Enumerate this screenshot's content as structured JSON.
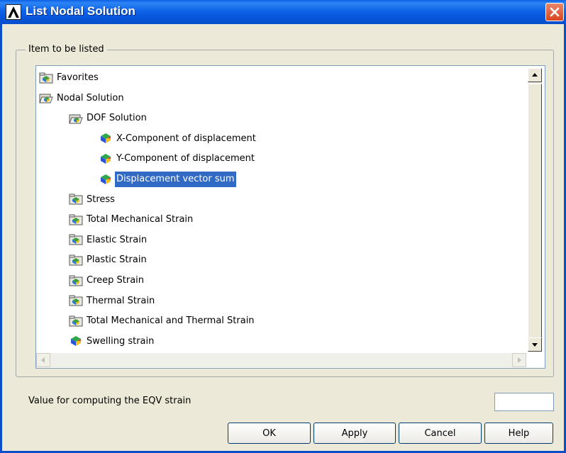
{
  "window": {
    "title": "List Nodal Solution",
    "close_icon": "close-icon"
  },
  "group": {
    "legend": "Item to be listed"
  },
  "tree": [
    {
      "label": "Favorites",
      "level": 0,
      "icon": "folder-icon",
      "selected": false
    },
    {
      "label": "Nodal Solution",
      "level": 0,
      "icon": "open-folder-icon",
      "selected": false
    },
    {
      "label": "DOF Solution",
      "level": 1,
      "icon": "open-folder-icon",
      "selected": false
    },
    {
      "label": "X-Component of displacement",
      "level": 2,
      "icon": "cube-icon",
      "selected": false
    },
    {
      "label": "Y-Component of displacement",
      "level": 2,
      "icon": "cube-icon",
      "selected": false
    },
    {
      "label": "Displacement vector sum",
      "level": 2,
      "icon": "cube-icon",
      "selected": true
    },
    {
      "label": "Stress",
      "level": 1,
      "icon": "folder-icon",
      "selected": false
    },
    {
      "label": "Total Mechanical Strain",
      "level": 1,
      "icon": "folder-icon",
      "selected": false
    },
    {
      "label": "Elastic Strain",
      "level": 1,
      "icon": "folder-icon",
      "selected": false
    },
    {
      "label": "Plastic Strain",
      "level": 1,
      "icon": "folder-icon",
      "selected": false
    },
    {
      "label": "Creep Strain",
      "level": 1,
      "icon": "folder-icon",
      "selected": false
    },
    {
      "label": "Thermal Strain",
      "level": 1,
      "icon": "folder-icon",
      "selected": false
    },
    {
      "label": "Total Mechanical and Thermal Strain",
      "level": 1,
      "icon": "folder-icon",
      "selected": false
    },
    {
      "label": "Swelling strain",
      "level": 1,
      "icon": "cube-icon",
      "selected": false
    }
  ],
  "value_field": {
    "label": "Value for computing the EQV strain",
    "value": ""
  },
  "buttons": {
    "ok": "OK",
    "apply": "Apply",
    "cancel": "Cancel",
    "help": "Help"
  },
  "colors": {
    "title_bar": "#0A5FE3",
    "selection": "#316AC5",
    "dialog_bg": "#ECE9D8"
  }
}
